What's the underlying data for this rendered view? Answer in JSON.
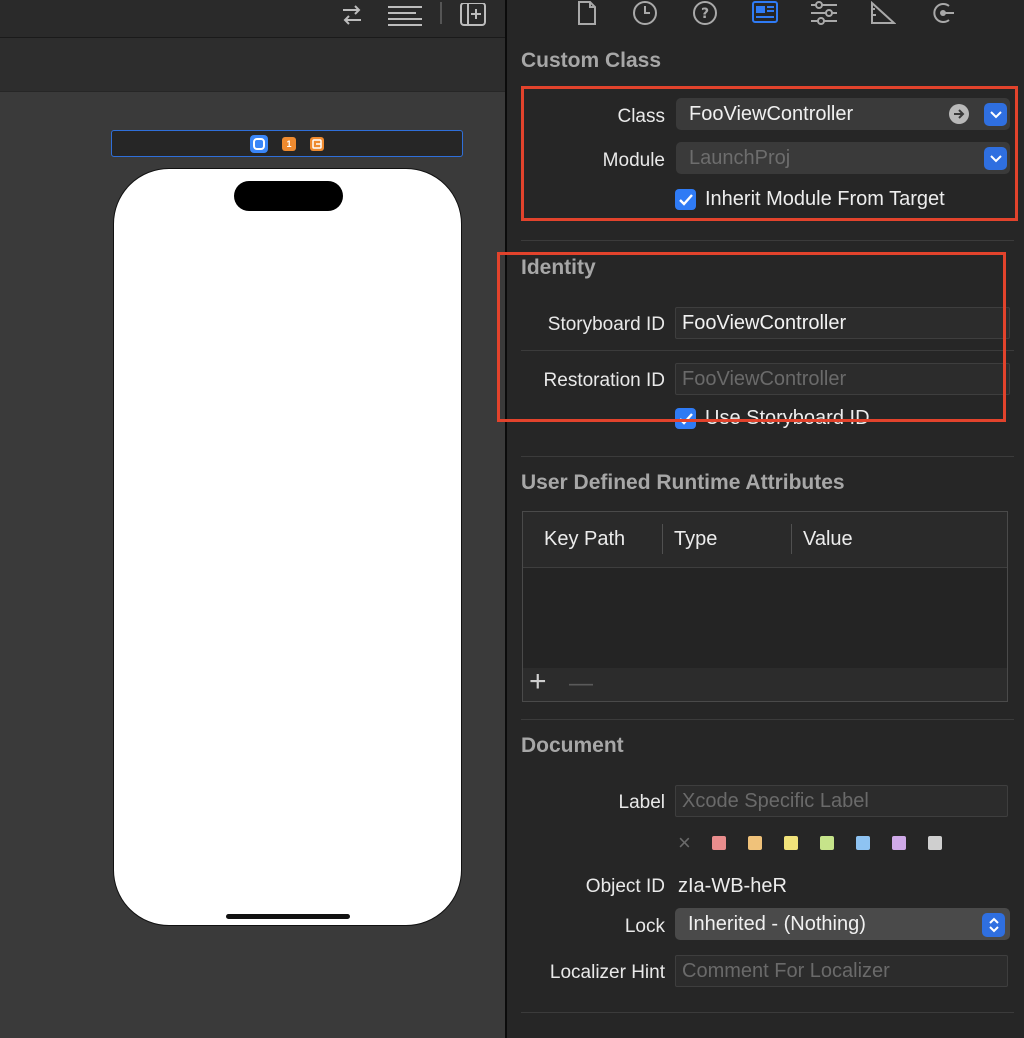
{
  "custom_class": {
    "title": "Custom Class",
    "class_label": "Class",
    "class_value": "FooViewController",
    "module_label": "Module",
    "module_value": "LaunchProj",
    "inherit_label": "Inherit Module From Target"
  },
  "identity": {
    "title": "Identity",
    "storyboard_id_label": "Storyboard ID",
    "storyboard_id_value": "FooViewController",
    "restoration_id_label": "Restoration ID",
    "restoration_id_value": "FooViewController",
    "use_storyboard_id_label": "Use Storyboard ID"
  },
  "runtime_attributes": {
    "title": "User Defined Runtime Attributes",
    "columns": [
      "Key Path",
      "Type",
      "Value"
    ],
    "add_symbol": "+",
    "remove_symbol": "—"
  },
  "document": {
    "title": "Document",
    "label_label": "Label",
    "label_placeholder": "Xcode Specific Label",
    "clear_symbol": "×",
    "swatches": [
      "#e98d8d",
      "#f0c27a",
      "#f0e27a",
      "#c6e48a",
      "#8ec3f2",
      "#cfa9e8",
      "#cfcfcf"
    ],
    "object_id_label": "Object ID",
    "object_id_value": "zIa-WB-heR",
    "lock_label": "Lock",
    "lock_value": "Inherited - (Nothing)",
    "localizer_hint_label": "Localizer Hint",
    "localizer_hint_placeholder": "Comment For Localizer"
  },
  "scene_dock": {
    "first_responder_badge": "1"
  },
  "colors": {
    "accent": "#2f7bf5",
    "highlight_box": "#e2432c"
  }
}
